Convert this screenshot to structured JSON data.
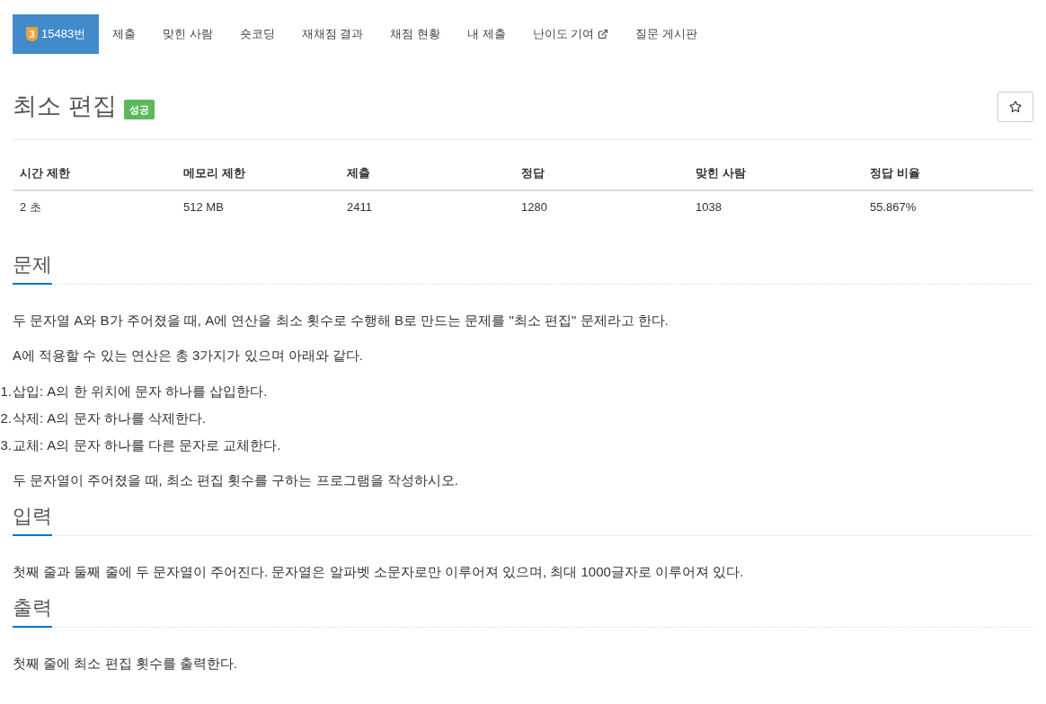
{
  "tabs": [
    {
      "label": "15483번",
      "tier": "3",
      "selected": true,
      "external": false
    },
    {
      "label": "제출",
      "selected": false,
      "external": false
    },
    {
      "label": "맞힌 사람",
      "selected": false,
      "external": false
    },
    {
      "label": "숏코딩",
      "selected": false,
      "external": false
    },
    {
      "label": "재채점 결과",
      "selected": false,
      "external": false
    },
    {
      "label": "채점 현황",
      "selected": false,
      "external": false
    },
    {
      "label": "내 제출",
      "selected": false,
      "external": false
    },
    {
      "label": "난이도 기여",
      "selected": false,
      "external": true
    },
    {
      "label": "질문 게시판",
      "selected": false,
      "external": false
    }
  ],
  "problem": {
    "title": "최소 편집",
    "result_badge": "성공"
  },
  "info_table": {
    "columns": [
      "시간 제한",
      "메모리 제한",
      "제출",
      "정답",
      "맞힌 사람",
      "정답 비율"
    ],
    "rows": [
      [
        "2 초",
        "512 MB",
        "2411",
        "1280",
        "1038",
        "55.867%"
      ]
    ]
  },
  "sections": [
    {
      "heading": "문제",
      "blocks": [
        {
          "kind": "paragraph",
          "text": "두 문자열 A와 B가 주어졌을 때, A에 연산을 최소 횟수로 수행해 B로 만드는 문제를 \"최소 편집\" 문제라고 한다."
        },
        {
          "kind": "paragraph",
          "text": "A에 적용할 수 있는 연산은 총 3가지가 있으며 아래와 같다."
        },
        {
          "kind": "list",
          "items": [
            {
              "number": "1.",
              "text": "삽입: A의 한 위치에 문자 하나를 삽입한다."
            },
            {
              "number": "2.",
              "text": "삭제: A의 문자 하나를 삭제한다."
            },
            {
              "number": "3.",
              "text": "교체: A의 문자 하나를 다른 문자로 교체한다."
            }
          ]
        },
        {
          "kind": "paragraph",
          "text": "두 문자열이 주어졌을 때, 최소 편집 횟수를 구하는 프로그램을 작성하시오."
        }
      ]
    },
    {
      "heading": "입력",
      "blocks": [
        {
          "kind": "paragraph",
          "text": "첫째 줄과 둘째 줄에 두 문자열이 주어진다. 문자열은 알파벳 소문자로만 이루어져 있으며, 최대 1000글자로 이루어져 있다."
        }
      ]
    },
    {
      "heading": "출력",
      "blocks": [
        {
          "kind": "paragraph",
          "text": "첫째 줄에 최소 편집 횟수를 출력한다."
        }
      ]
    }
  ]
}
